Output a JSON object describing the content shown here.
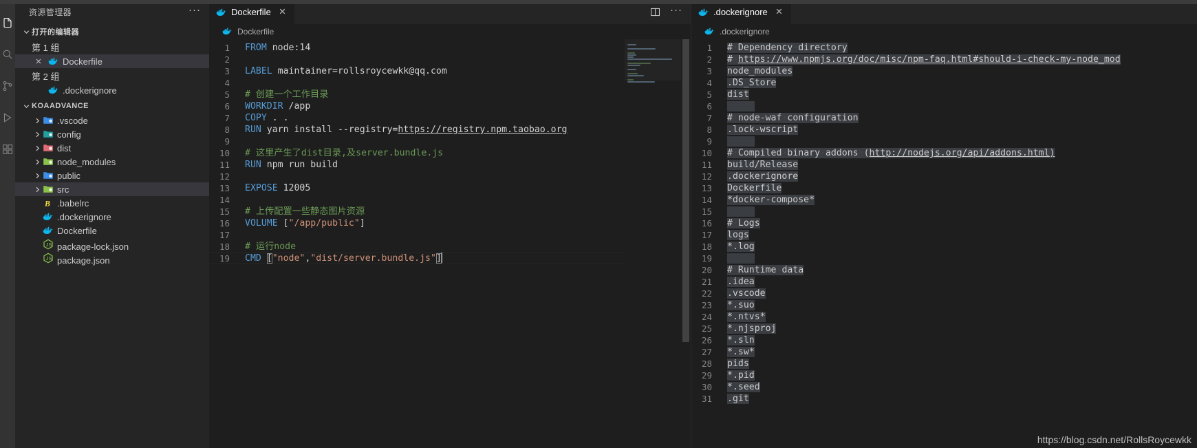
{
  "activitybar": {
    "items": [
      {
        "name": "explorer-icon",
        "active": true
      },
      {
        "name": "search-icon",
        "active": false
      },
      {
        "name": "source-control-icon",
        "active": false
      },
      {
        "name": "run-debug-icon",
        "active": false
      },
      {
        "name": "extensions-icon",
        "active": false
      }
    ]
  },
  "sidebar": {
    "title": "资源管理器",
    "more_label": "···",
    "open_editors": {
      "header": "打开的编辑器",
      "groups": [
        {
          "label": "第 1 组",
          "items": [
            {
              "name": "Dockerfile",
              "icon": "docker-icon",
              "selected": true,
              "closeable": true
            }
          ]
        },
        {
          "label": "第 2 组",
          "items": [
            {
              "name": ".dockerignore",
              "icon": "docker-icon",
              "selected": false,
              "closeable": false
            }
          ]
        }
      ]
    },
    "project": {
      "header": "KOAADVANCE",
      "folders": [
        {
          "name": ".vscode",
          "icon": "folder-vscode",
          "color": "#3b8eea",
          "selected": false
        },
        {
          "name": "config",
          "icon": "folder-config",
          "color": "#21a0a0",
          "selected": false
        },
        {
          "name": "dist",
          "icon": "folder-dist",
          "color": "#e06c75",
          "selected": false
        },
        {
          "name": "node_modules",
          "icon": "folder-node",
          "color": "#8bc34a",
          "selected": false
        },
        {
          "name": "public",
          "icon": "folder-public",
          "color": "#3b8eea",
          "selected": false
        },
        {
          "name": "src",
          "icon": "folder-src",
          "color": "#8bc34a",
          "selected": true
        }
      ],
      "files": [
        {
          "name": ".babelrc",
          "icon": "babel-icon",
          "color": "#f9dc3e"
        },
        {
          "name": ".dockerignore",
          "icon": "docker-icon",
          "color": "#0db7ed"
        },
        {
          "name": "Dockerfile",
          "icon": "docker-icon",
          "color": "#0db7ed"
        },
        {
          "name": "package-lock.json",
          "icon": "node-icon",
          "color": "#8bc34a"
        },
        {
          "name": "package.json",
          "icon": "node-icon",
          "color": "#8bc34a"
        }
      ]
    }
  },
  "editor_left": {
    "tab": {
      "label": "Dockerfile",
      "icon": "docker-icon",
      "close": "✕"
    },
    "actions": [
      {
        "name": "split-editor-icon",
        "label": ""
      },
      {
        "name": "more-actions-icon",
        "label": "···"
      }
    ],
    "breadcrumb": "Dockerfile",
    "lines": [
      {
        "n": 1,
        "tokens": [
          {
            "t": "FROM",
            "c": "kw"
          },
          {
            "t": " node:14",
            "c": "plain"
          }
        ]
      },
      {
        "n": 2,
        "tokens": []
      },
      {
        "n": 3,
        "tokens": [
          {
            "t": "LABEL",
            "c": "kw"
          },
          {
            "t": " maintainer=rollsroycewkk@qq.com",
            "c": "plain"
          }
        ]
      },
      {
        "n": 4,
        "tokens": []
      },
      {
        "n": 5,
        "tokens": [
          {
            "t": "# 创建一个工作目录",
            "c": "cmt"
          }
        ]
      },
      {
        "n": 6,
        "tokens": [
          {
            "t": "WORKDIR",
            "c": "kw"
          },
          {
            "t": " /app",
            "c": "plain"
          }
        ]
      },
      {
        "n": 7,
        "tokens": [
          {
            "t": "COPY",
            "c": "kw"
          },
          {
            "t": " . .",
            "c": "plain"
          }
        ]
      },
      {
        "n": 8,
        "tokens": [
          {
            "t": "RUN",
            "c": "kw"
          },
          {
            "t": " yarn install --registry=",
            "c": "plain"
          },
          {
            "t": "https://registry.npm.taobao.org",
            "c": "plain link"
          }
        ]
      },
      {
        "n": 9,
        "tokens": []
      },
      {
        "n": 10,
        "tokens": [
          {
            "t": "# 这里产生了dist目录,及server.bundle.js",
            "c": "cmt"
          }
        ]
      },
      {
        "n": 11,
        "tokens": [
          {
            "t": "RUN",
            "c": "kw"
          },
          {
            "t": " npm run build",
            "c": "plain"
          }
        ]
      },
      {
        "n": 12,
        "tokens": []
      },
      {
        "n": 13,
        "tokens": [
          {
            "t": "EXPOSE",
            "c": "kw"
          },
          {
            "t": " 12005",
            "c": "plain"
          }
        ]
      },
      {
        "n": 14,
        "tokens": []
      },
      {
        "n": 15,
        "tokens": [
          {
            "t": "# 上传配置一些静态图片资源",
            "c": "cmt"
          }
        ]
      },
      {
        "n": 16,
        "tokens": [
          {
            "t": "VOLUME",
            "c": "kw"
          },
          {
            "t": " ",
            "c": "plain"
          },
          {
            "t": "[",
            "c": "punc"
          },
          {
            "t": "\"/app/public\"",
            "c": "str"
          },
          {
            "t": "]",
            "c": "punc"
          }
        ]
      },
      {
        "n": 17,
        "tokens": []
      },
      {
        "n": 18,
        "tokens": [
          {
            "t": "# 运行node",
            "c": "cmt"
          }
        ]
      },
      {
        "n": 19,
        "tokens": [
          {
            "t": "CMD",
            "c": "kw"
          },
          {
            "t": " ",
            "c": "plain"
          },
          {
            "t": "[",
            "c": "punc bracket-match"
          },
          {
            "t": "\"node\"",
            "c": "str"
          },
          {
            "t": ",",
            "c": "punc"
          },
          {
            "t": "\"dist/server.bundle.js\"",
            "c": "str"
          },
          {
            "t": "]",
            "c": "punc bracket-match"
          }
        ],
        "cursor": true,
        "current": true
      }
    ]
  },
  "editor_right": {
    "tab": {
      "label": ".dockerignore",
      "icon": "docker-icon",
      "close": "✕"
    },
    "breadcrumb": ".dockerignore",
    "lines": [
      {
        "n": 1,
        "text": "# Dependency directory",
        "selected": true
      },
      {
        "n": 2,
        "text": "# https://www.npmjs.org/doc/misc/npm-faq.html#should-i-check-my-node_mod",
        "selected": true,
        "link_from": 2
      },
      {
        "n": 3,
        "text": "node_modules",
        "selected": true
      },
      {
        "n": 4,
        "text": ".DS_Store",
        "selected": true
      },
      {
        "n": 5,
        "text": "dist",
        "selected": true
      },
      {
        "n": 6,
        "text": "",
        "selected": true
      },
      {
        "n": 7,
        "text": "# node-waf configuration",
        "selected": true
      },
      {
        "n": 8,
        "text": ".lock-wscript",
        "selected": true
      },
      {
        "n": 9,
        "text": "",
        "selected": true
      },
      {
        "n": 10,
        "text": "# Compiled binary addons (http://nodejs.org/api/addons.html)",
        "selected": true,
        "link_from": 26
      },
      {
        "n": 11,
        "text": "build/Release",
        "selected": true
      },
      {
        "n": 12,
        "text": ".dockerignore",
        "selected": true
      },
      {
        "n": 13,
        "text": "Dockerfile",
        "selected": true
      },
      {
        "n": 14,
        "text": "*docker-compose*",
        "selected": true
      },
      {
        "n": 15,
        "text": "",
        "selected": true
      },
      {
        "n": 16,
        "text": "# Logs",
        "selected": true
      },
      {
        "n": 17,
        "text": "logs",
        "selected": true
      },
      {
        "n": 18,
        "text": "*.log",
        "selected": true
      },
      {
        "n": 19,
        "text": "",
        "selected": true
      },
      {
        "n": 20,
        "text": "# Runtime data",
        "selected": true
      },
      {
        "n": 21,
        "text": ".idea",
        "selected": true
      },
      {
        "n": 22,
        "text": ".vscode",
        "selected": true
      },
      {
        "n": 23,
        "text": "*.suo",
        "selected": true
      },
      {
        "n": 24,
        "text": "*.ntvs*",
        "selected": true
      },
      {
        "n": 25,
        "text": "*.njsproj",
        "selected": true
      },
      {
        "n": 26,
        "text": "*.sln",
        "selected": true
      },
      {
        "n": 27,
        "text": "*.sw*",
        "selected": true
      },
      {
        "n": 28,
        "text": "pids",
        "selected": true
      },
      {
        "n": 29,
        "text": "*.pid",
        "selected": true
      },
      {
        "n": 30,
        "text": "*.seed",
        "selected": true
      },
      {
        "n": 31,
        "text": ".git",
        "selected": true
      }
    ]
  },
  "watermark": "https://blog.csdn.net/RollsRoycewkk",
  "colors": {
    "background": "#1e1e1e",
    "sidebar": "#252526",
    "activitybar": "#333333",
    "keyword": "#569cd6",
    "comment": "#6a9955",
    "string": "#ce9178",
    "text": "#d4d4d4",
    "linenumber": "#858585",
    "selection": "#3a3d41",
    "docker_blue": "#0db7ed"
  }
}
